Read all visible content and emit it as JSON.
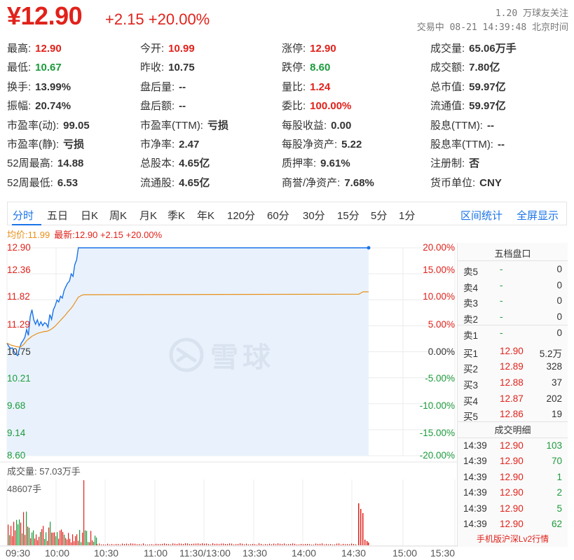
{
  "header": {
    "price": "¥12.90",
    "change": "+2.15 +20.00%",
    "follow": "1.20 万球友关注",
    "status": "交易中 08-21 14:39:48 北京时间"
  },
  "quote_rows": [
    [
      {
        "label": "最高:",
        "value": "12.90",
        "color": "red"
      },
      {
        "label": "今开:",
        "value": "10.99",
        "color": "red"
      },
      {
        "label": "涨停:",
        "value": "12.90",
        "color": "red"
      },
      {
        "label": "成交量:",
        "value": "65.06万手",
        "color": ""
      }
    ],
    [
      {
        "label": "最低:",
        "value": "10.67",
        "color": "green"
      },
      {
        "label": "昨收:",
        "value": "10.75",
        "color": ""
      },
      {
        "label": "跌停:",
        "value": "8.60",
        "color": "green"
      },
      {
        "label": "成交额:",
        "value": "7.80亿",
        "color": ""
      }
    ],
    [
      {
        "label": "换手:",
        "value": "13.99%",
        "color": ""
      },
      {
        "label": "盘后量:",
        "value": "--",
        "color": ""
      },
      {
        "label": "量比:",
        "value": "1.24",
        "color": "red"
      },
      {
        "label": "总市值:",
        "value": "59.97亿",
        "color": ""
      }
    ],
    [
      {
        "label": "振幅:",
        "value": "20.74%",
        "color": ""
      },
      {
        "label": "盘后额:",
        "value": "--",
        "color": ""
      },
      {
        "label": "委比:",
        "value": "100.00%",
        "color": "red"
      },
      {
        "label": "流通值:",
        "value": "59.97亿",
        "color": ""
      }
    ],
    [
      {
        "label": "市盈率(动):",
        "value": "99.05",
        "color": ""
      },
      {
        "label": "市盈率(TTM):",
        "value": "亏损",
        "color": ""
      },
      {
        "label": "每股收益:",
        "value": "0.00",
        "color": ""
      },
      {
        "label": "股息(TTM):",
        "value": "--",
        "color": ""
      }
    ],
    [
      {
        "label": "市盈率(静):",
        "value": "亏损",
        "color": ""
      },
      {
        "label": "市净率:",
        "value": "2.47",
        "color": ""
      },
      {
        "label": "每股净资产:",
        "value": "5.22",
        "color": ""
      },
      {
        "label": "股息率(TTM):",
        "value": "--",
        "color": ""
      }
    ],
    [
      {
        "label": "52周最高:",
        "value": "14.88",
        "color": ""
      },
      {
        "label": "总股本:",
        "value": "4.65亿",
        "color": ""
      },
      {
        "label": "质押率:",
        "value": "9.61%",
        "color": ""
      },
      {
        "label": "注册制:",
        "value": "否",
        "color": ""
      }
    ],
    [
      {
        "label": "52周最低:",
        "value": "6.53",
        "color": ""
      },
      {
        "label": "流通股:",
        "value": "4.65亿",
        "color": ""
      },
      {
        "label": "商誉/净资产:",
        "value": "7.68%",
        "color": ""
      },
      {
        "label": "货币单位:",
        "value": "CNY",
        "color": ""
      }
    ]
  ],
  "tabs": [
    "分时",
    "五日",
    "日K",
    "周K",
    "月K",
    "季K",
    "年K",
    "120分",
    "60分",
    "30分",
    "15分",
    "5分",
    "1分"
  ],
  "tabs_right": [
    "区间统计",
    "全屏显示"
  ],
  "legend": {
    "avg": "均价:11.99",
    "last": "最新:12.90 +2.15 +20.00%"
  },
  "chart_data": {
    "type": "line",
    "y_left_ticks": [
      "12.90",
      "12.36",
      "11.82",
      "11.29",
      "10.75",
      "10.21",
      "9.68",
      "9.14",
      "8.60"
    ],
    "y_right_ticks": [
      "20.00%",
      "15.00%",
      "10.00%",
      "5.00%",
      "0.00%",
      "-5.00%",
      "-10.00%",
      "-15.00%",
      "-20.00%"
    ],
    "ylim": [
      8.6,
      12.9
    ],
    "x_ticks": [
      "09:30",
      "10:00",
      "10:30",
      "11:00",
      "11:30/13:00",
      "13:30",
      "14:00",
      "14:30",
      "15:00",
      "15:30"
    ],
    "series": [
      {
        "values": [
          10.93,
          10.86,
          10.82,
          10.83,
          10.75,
          10.7,
          10.67,
          10.82,
          10.93,
          10.98,
          11.05,
          11.21,
          11.09,
          11.48,
          11.62,
          11.41,
          11.32,
          11.41,
          11.29,
          11.37,
          11.29,
          11.35,
          11.33,
          11.26,
          11.52,
          11.42,
          11.62,
          11.7,
          11.82,
          11.78,
          11.9,
          11.86,
          12.02,
          12.1,
          12.17,
          12.21,
          12.36,
          12.31,
          12.55,
          12.65,
          12.9,
          12.9,
          12.9,
          12.9,
          12.9
        ]
      },
      {
        "values": [
          10.93,
          10.91,
          10.89,
          10.88,
          10.87,
          10.86,
          10.85,
          10.85,
          10.86,
          10.89,
          10.93,
          10.98,
          11.01,
          11.04,
          11.07,
          11.09,
          11.11,
          11.13,
          11.14,
          11.15,
          11.16,
          11.17,
          11.17,
          11.18,
          11.2,
          11.22,
          11.25,
          11.28,
          11.32,
          11.36,
          11.4,
          11.44,
          11.48,
          11.52,
          11.57,
          11.61,
          11.65,
          11.7,
          11.76,
          11.82,
          11.88,
          11.9,
          11.92,
          11.93,
          11.93
        ]
      }
    ],
    "series_tail": {
      "flat_price": 12.9,
      "avg_end": [
        11.94,
        11.99
      ]
    },
    "volume": {
      "label": "成交量: 57.03万手",
      "max_label": "48607手"
    }
  },
  "order_book": {
    "title": "五档盘口",
    "rows": [
      {
        "l": "卖5",
        "p": "-",
        "v": "0"
      },
      {
        "l": "卖4",
        "p": "-",
        "v": "0"
      },
      {
        "l": "卖3",
        "p": "-",
        "v": "0"
      },
      {
        "l": "卖2",
        "p": "-",
        "v": "0"
      },
      {
        "l": "卖1",
        "p": "-",
        "v": "0"
      },
      {
        "l": "买1",
        "p": "12.90",
        "v": "5.2万"
      },
      {
        "l": "买2",
        "p": "12.89",
        "v": "328"
      },
      {
        "l": "买3",
        "p": "12.88",
        "v": "37"
      },
      {
        "l": "买4",
        "p": "12.87",
        "v": "202"
      },
      {
        "l": "买5",
        "p": "12.86",
        "v": "19"
      }
    ]
  },
  "trades": {
    "title": "成交明细",
    "rows": [
      {
        "t": "14:39",
        "p": "12.90",
        "v": "103"
      },
      {
        "t": "14:39",
        "p": "12.90",
        "v": "70"
      },
      {
        "t": "14:39",
        "p": "12.90",
        "v": "1"
      },
      {
        "t": "14:39",
        "p": "12.90",
        "v": "2"
      },
      {
        "t": "14:39",
        "p": "12.90",
        "v": "5"
      },
      {
        "t": "14:39",
        "p": "12.90",
        "v": "62"
      }
    ],
    "footer": "手机版沪深Lv2行情"
  },
  "colors": {
    "up": "#e0221b",
    "down": "#1c9b3c",
    "accent": "#1a73e8",
    "avg": "#e8901a"
  },
  "watermark": {
    "text": "雪球",
    "icon": "snowball-logo-icon"
  }
}
